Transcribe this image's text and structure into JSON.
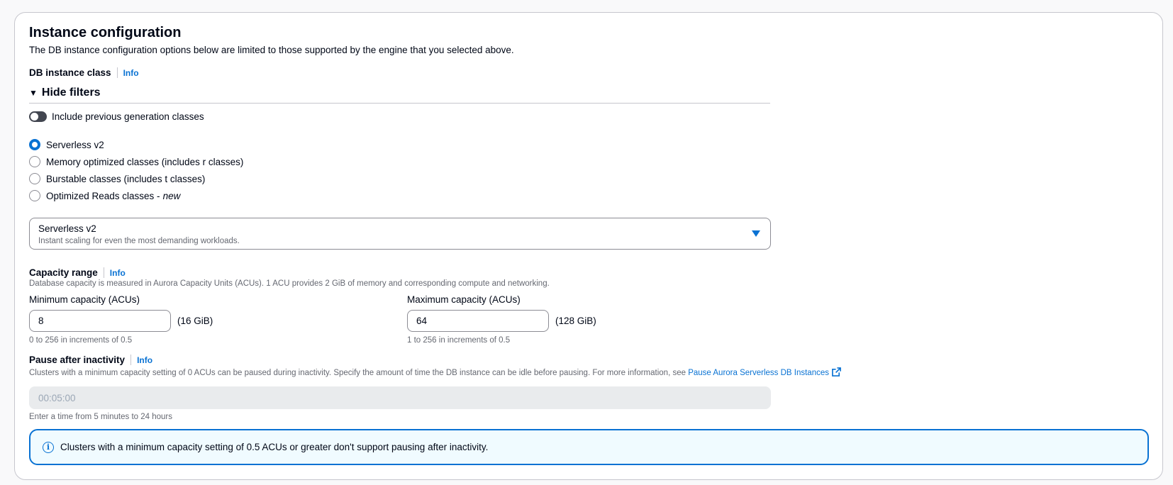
{
  "section": {
    "title": "Instance configuration",
    "description": "The DB instance configuration options below are limited to those supported by the engine that you selected above."
  },
  "db_class": {
    "label": "DB instance class",
    "info": "Info",
    "filters_toggle": "Hide filters",
    "prev_gen_label": "Include previous generation classes",
    "prev_gen_enabled": false,
    "options": [
      {
        "label": "Serverless v2",
        "suffix": "",
        "selected": true
      },
      {
        "label": "Memory optimized classes (includes r classes)",
        "suffix": "",
        "selected": false
      },
      {
        "label": "Burstable classes (includes t classes)",
        "suffix": "",
        "selected": false
      },
      {
        "label": "Optimized Reads classes - ",
        "suffix": "new",
        "selected": false
      }
    ],
    "select_value": "Serverless v2",
    "select_description": "Instant scaling for even the most demanding workloads."
  },
  "capacity": {
    "label": "Capacity range",
    "info": "Info",
    "description": "Database capacity is measured in Aurora Capacity Units (ACUs). 1 ACU provides 2 GiB of memory and corresponding compute and networking.",
    "min_label": "Minimum capacity (ACUs)",
    "min_value": "8",
    "min_unit": "(16 GiB)",
    "min_hint": "0 to 256 in increments of 0.5",
    "max_label": "Maximum capacity (ACUs)",
    "max_value": "64",
    "max_unit": "(128 GiB)",
    "max_hint": "1 to 256 in increments of 0.5"
  },
  "pause": {
    "label": "Pause after inactivity",
    "info": "Info",
    "description": "Clusters with a minimum capacity setting of 0 ACUs can be paused during inactivity. Specify the amount of time the DB instance can be idle before pausing. For more information, see",
    "link": "Pause Aurora Serverless DB Instances",
    "value": "00:05:00",
    "hint": "Enter a time from 5 minutes to 24 hours"
  },
  "alert": {
    "text": "Clusters with a minimum capacity setting of 0.5 ACUs or greater don't support pausing after inactivity."
  },
  "colors": {
    "accent": "#0972d3",
    "alert_bg": "#f0fbff"
  }
}
